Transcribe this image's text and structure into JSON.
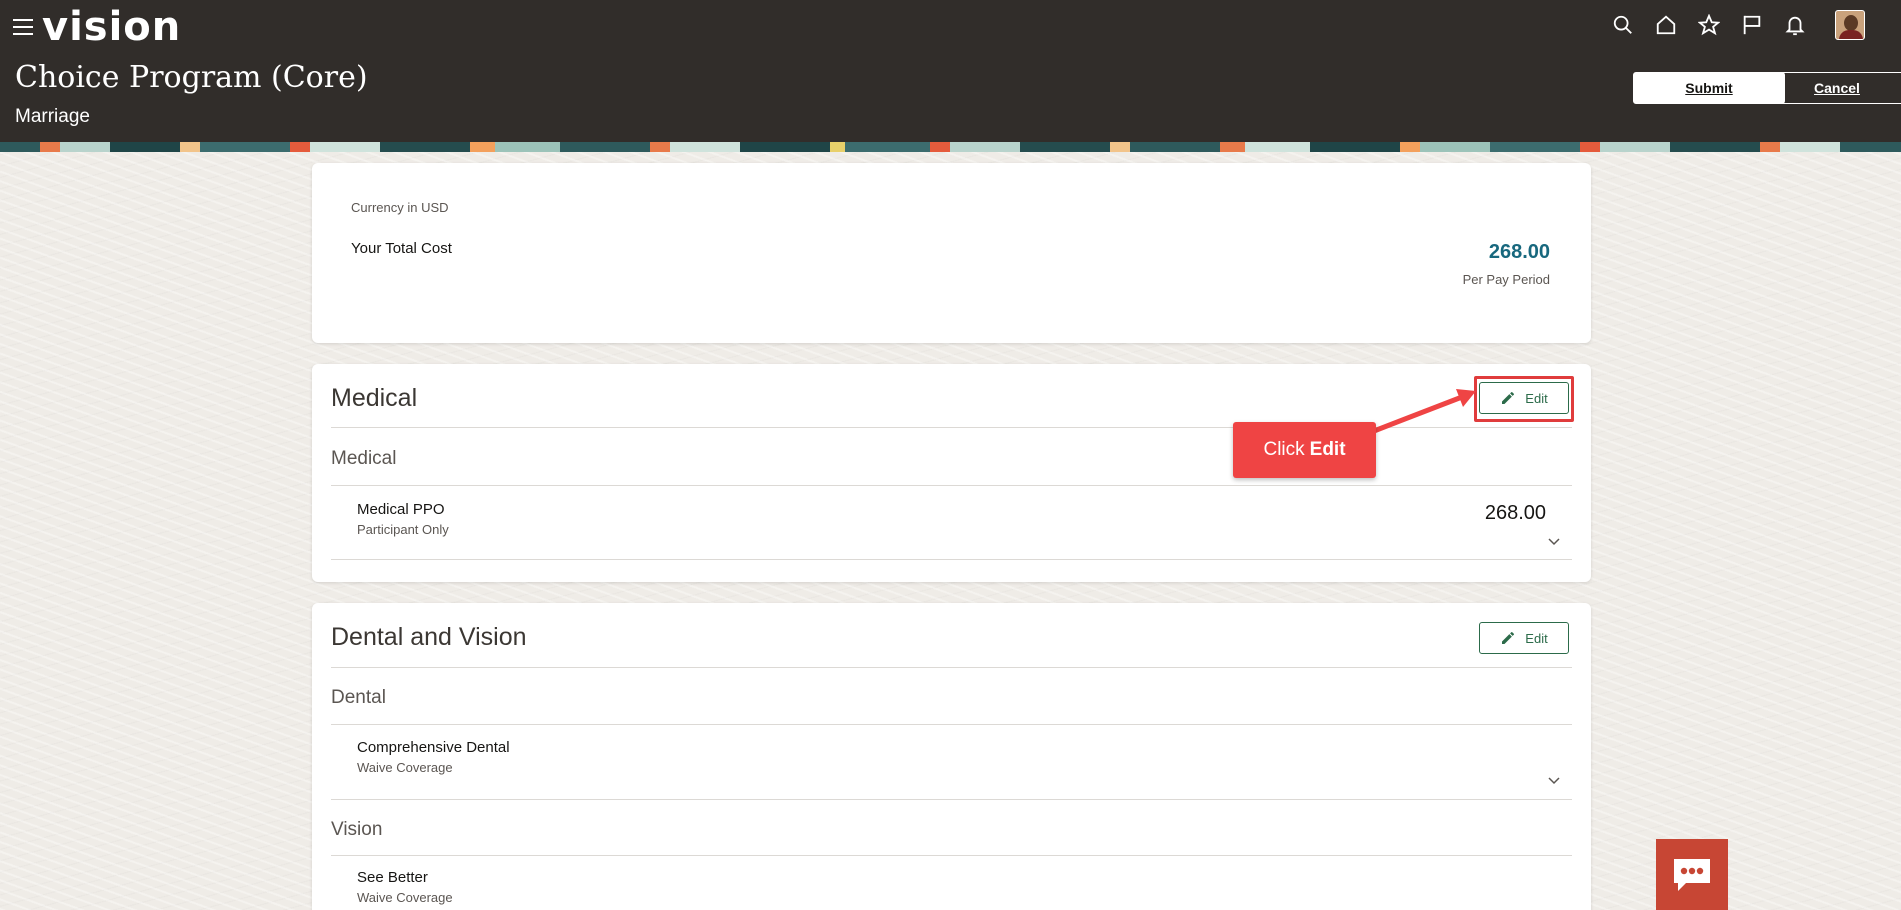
{
  "app": {
    "logo": "vision"
  },
  "header": {
    "title": "Choice Program (Core)",
    "subtitle": "Marriage",
    "submit_label": "Submit",
    "cancel_label": "Cancel",
    "icons": [
      "search-icon",
      "home-icon",
      "star-icon",
      "flag-icon",
      "bell-icon",
      "avatar"
    ]
  },
  "summary": {
    "currency_note": "Currency in USD",
    "total_label": "Your Total Cost",
    "total_value": "268.00",
    "period": "Per Pay Period"
  },
  "sections": [
    {
      "title": "Medical",
      "edit_label": "Edit",
      "groups": [
        {
          "title": "Medical",
          "plans": [
            {
              "name": "Medical PPO",
              "option": "Participant Only",
              "cost": "268.00"
            }
          ]
        }
      ]
    },
    {
      "title": "Dental and Vision",
      "edit_label": "Edit",
      "groups": [
        {
          "title": "Dental",
          "plans": [
            {
              "name": "Comprehensive Dental",
              "option": "Waive Coverage"
            }
          ]
        },
        {
          "title": "Vision",
          "plans": [
            {
              "name": "See Better",
              "option": "Waive Coverage"
            }
          ]
        }
      ]
    }
  ],
  "annotation": {
    "prefix": "Click",
    "target": "Edit"
  },
  "colors": {
    "header_bg": "#312d2a",
    "accent_teal": "#18687e",
    "edit_green": "#2c6b4a",
    "callout_red": "#ef4444",
    "chat_bg": "#c74634"
  }
}
